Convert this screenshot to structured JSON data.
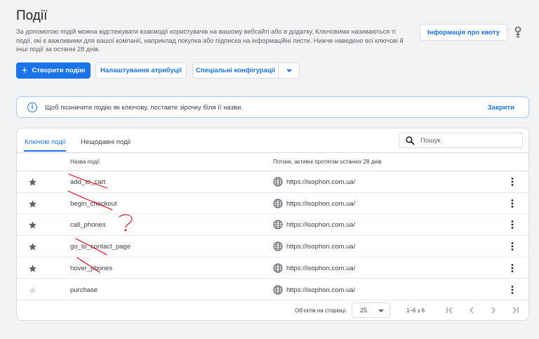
{
  "header": {
    "title": "Події",
    "description": "За допомогою подій можна відстежувати взаємодії користувачів на вашому вебсайті або в додатку. Ключовими називаються ті події, які є важливими для вашої компанії, наприклад покупка або підписка на інформаційні листи. Нижче наведено всі ключові й інші події за останні 28 днів.",
    "quota_button": "Інформація про квоту"
  },
  "toolbar": {
    "create_label": "Створити подію",
    "attribution_label": "Налаштування атрибуції",
    "config_label": "Спеціальні конфігурації"
  },
  "info_bar": {
    "text": "Щоб позначити подію як ключову, поставте зірочку біля її назви.",
    "close_label": "Закрити"
  },
  "tabs": [
    {
      "label": "Ключові події",
      "active": true
    },
    {
      "label": "Нещодавні події",
      "active": false
    }
  ],
  "search": {
    "placeholder": "Пошук",
    "value": ""
  },
  "table": {
    "columns": [
      "Назва події",
      "Потоки, активні протягом останніх 28 днів"
    ],
    "rows": [
      {
        "name": "add_to_cart",
        "stream": "https://isophon.com.ua/",
        "starred": true
      },
      {
        "name": "begin_checkout",
        "stream": "https://isophon.com.ua/",
        "starred": true
      },
      {
        "name": "call_phones",
        "stream": "https://isophon.com.ua/",
        "starred": true
      },
      {
        "name": "go_to_contact_page",
        "stream": "https://isophon.com.ua/",
        "starred": true
      },
      {
        "name": "hover_phones",
        "stream": "https://isophon.com.ua/",
        "starred": true
      },
      {
        "name": "purchase",
        "stream": "https://isophon.com.ua/",
        "starred": false
      }
    ]
  },
  "pagination": {
    "per_page_label": "Об'єктів на сторінці:",
    "per_page_value": "25",
    "range": "1–6 з 6"
  },
  "colors": {
    "accent": "#1a73e8",
    "star_on": "#5f6368",
    "star_off": "#dadce0",
    "annotation": "#e8000b"
  }
}
